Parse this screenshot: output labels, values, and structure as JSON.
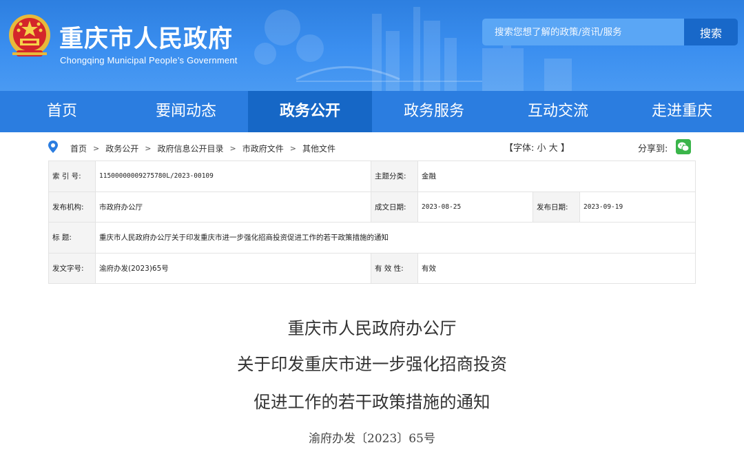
{
  "header": {
    "site_title": "重庆市人民政府",
    "site_subtitle": "Chongqing Municipal People’s Government",
    "search_placeholder": "搜索您想了解的政策/资讯/服务",
    "search_button": "搜索"
  },
  "nav": {
    "items": [
      "首页",
      "要闻动态",
      "政务公开",
      "政务服务",
      "互动交流",
      "走进重庆"
    ],
    "active": "政务公开"
  },
  "breadcrumb": {
    "items": [
      "首页",
      "政务公开",
      "政府信息公开目录",
      "市政府文件",
      "其他文件"
    ],
    "separator": ">"
  },
  "toolbar": {
    "font_open": "【字体:",
    "font_small": "小",
    "font_large": "大",
    "font_close": "】",
    "share_label": "分享到:"
  },
  "info": {
    "index_label": "索 引 号:",
    "index_value": "11500000009275780L/2023-00109",
    "topic_label": "主题分类:",
    "topic_value": "金融",
    "publisher_label": "发布机构:",
    "publisher_value": "市政府办公厅",
    "written_label": "成文日期:",
    "written_value": "2023-08-25",
    "published_label": "发布日期:",
    "published_value": "2023-09-19",
    "title_label": "标    题:",
    "title_value": "重庆市人民政府办公厅关于印发重庆市进一步强化招商投资促进工作的若干政策措施的通知",
    "docno_label": "发文字号:",
    "docno_value": "渝府办发(2023)65号",
    "validity_label": "有 效 性:",
    "validity_value": "有效"
  },
  "document": {
    "title_lines": [
      "重庆市人民政府办公厅",
      "关于印发重庆市进一步强化招商投资",
      "促进工作的若干政策措施的通知"
    ],
    "number": "渝府办发〔2023〕65号"
  },
  "colors": {
    "header_blue": "#3b8ff0",
    "nav_blue": "#2b7de0",
    "nav_active": "#1667c6",
    "search_button": "#1868c9",
    "wechat_green": "#3ab54a"
  },
  "icons": {
    "emblem": "national-emblem-icon",
    "location": "location-pin-icon",
    "wechat": "wechat-icon"
  }
}
